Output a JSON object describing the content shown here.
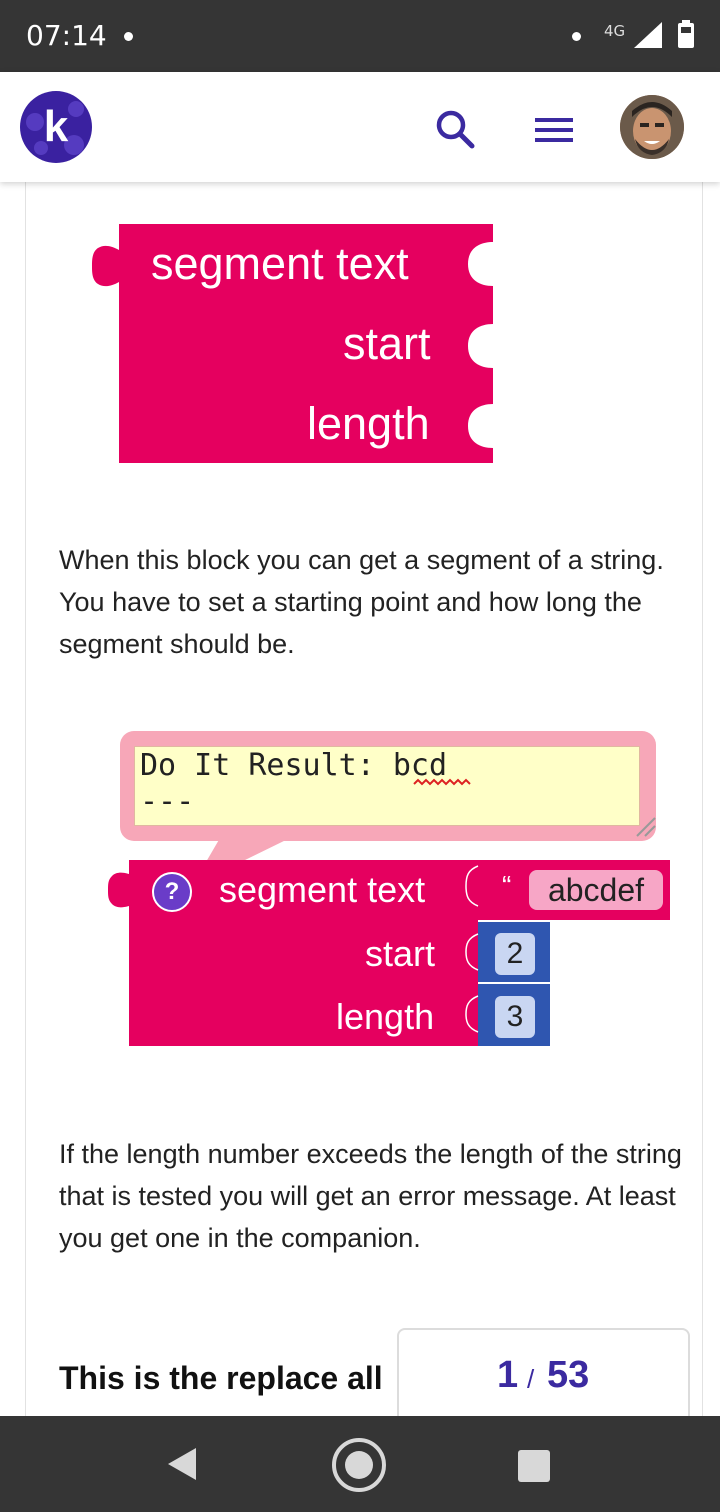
{
  "status_bar": {
    "time": "07:14",
    "network": "4G"
  },
  "header": {
    "logo_letter": "k",
    "search_icon": "search-icon",
    "menu_icon": "hamburger-menu-icon",
    "avatar": "user-avatar"
  },
  "block1": {
    "row1": "segment  text",
    "row2": "start",
    "row3": "length",
    "color": "#e5005f"
  },
  "paragraph1": "When this block you can get a segment of a string. You have to set a starting point and how long the segment should be.",
  "block2": {
    "comment_line1": "Do It Result: bcd",
    "comment_line2": "---",
    "help_glyph": "?",
    "row1": "segment  text",
    "quote_glyph": "“",
    "text_value": "abcdef",
    "row2": "start",
    "start_value": "2",
    "row3": "length",
    "length_value": "3",
    "math_color": "#2f56b0"
  },
  "paragraph2": "If the length number exceeds the length of the string that is tested you will get an error message. At least you get one in the companion.",
  "heading": "This is the replace all",
  "pager": {
    "current": "1",
    "separator": "/",
    "total": "53"
  },
  "nav": {
    "back_icon": "back-triangle-icon",
    "home_icon": "home-circle-icon",
    "recents_icon": "recents-square-icon"
  }
}
